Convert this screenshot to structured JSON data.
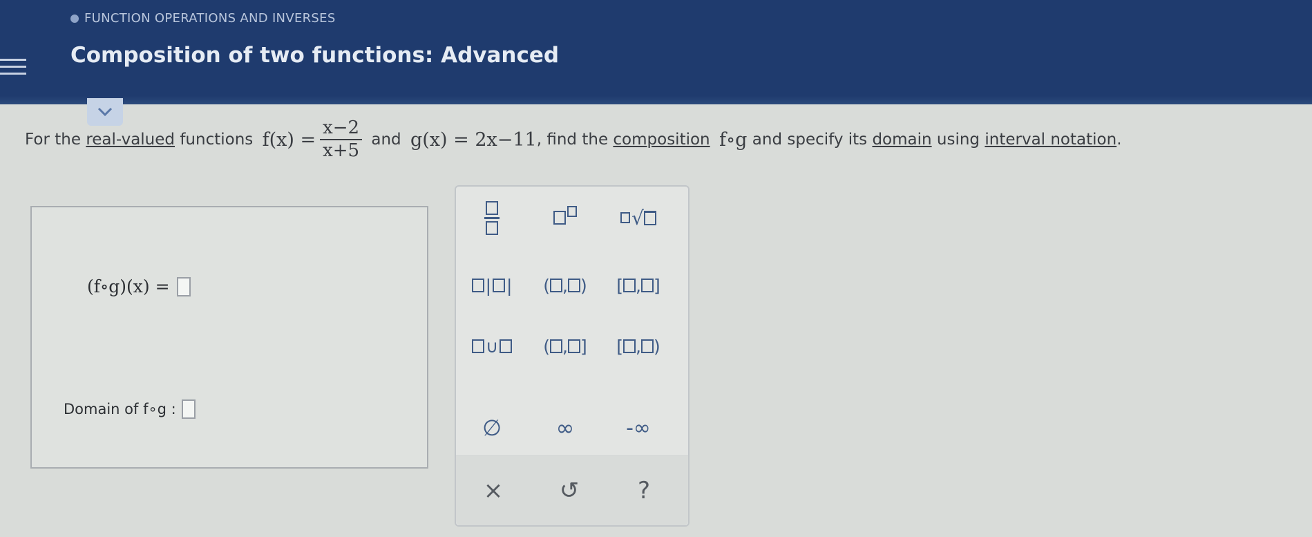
{
  "header": {
    "breadcrumb": "FUNCTION OPERATIONS AND INVERSES",
    "title": "Composition of two functions: Advanced"
  },
  "problem": {
    "intro": "For the",
    "real_valued": "real-valued",
    "functions_word": "functions",
    "f_def": "f(x) =",
    "f_numerator": "x−2",
    "f_denominator": "x+5",
    "and_word": "and",
    "g_def": "g(x) = 2x−11",
    "find_text": ", find the",
    "composition_link": "composition",
    "fog": "f∘g",
    "specify_text": "and specify its",
    "domain_link": "domain",
    "using_text": "using",
    "interval_link": "interval notation",
    "period": "."
  },
  "answer": {
    "composition_label": "(f∘g)(x) =",
    "domain_label": "Domain of f∘g :"
  },
  "keypad": {
    "interval_open_open": "( , )",
    "interval_closed_closed": "[ , ]",
    "interval_open_closed": "( , ]",
    "interval_closed_open": "[ , )",
    "union": "∪",
    "empty_set": "∅",
    "infinity": "∞",
    "neg_infinity": "-∞",
    "clear": "×",
    "undo": "↺",
    "help": "?"
  },
  "colors": {
    "header_bg": "#1f3b6e",
    "keypad_symbol": "#3f5b86",
    "panel_border": "#a9adb1"
  }
}
